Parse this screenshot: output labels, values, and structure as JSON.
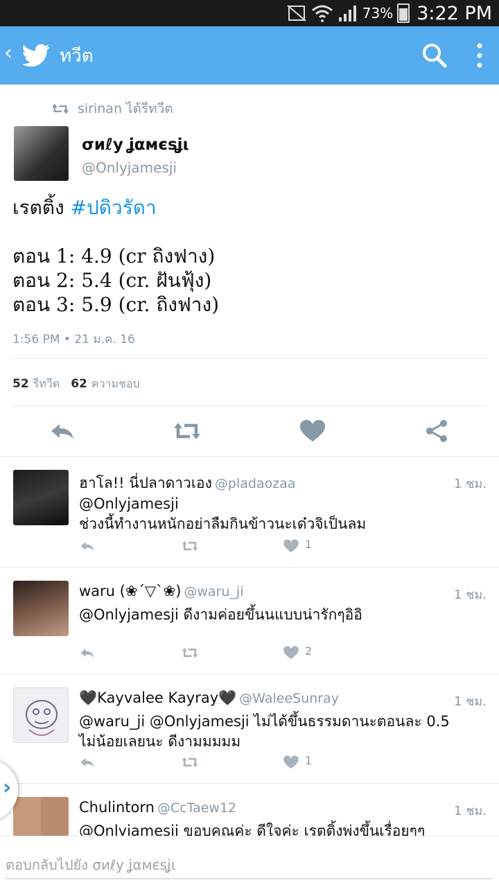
{
  "status_bar": {
    "battery": "73%",
    "time": "3:22 PM"
  },
  "app_bar": {
    "title": "ทวีต"
  },
  "main_tweet": {
    "retweeted_by": "sirinan ได้รีทวีต",
    "author_name": "σиℓу ʝαмєѕʝι",
    "author_handle": "@Onlyjamesji",
    "text_prefix": "เรตติ้ง ",
    "hashtag": "#ปดิวรัดา",
    "text_body": "\n\nตอน 1: 4.9 (cr ถิงฟาง)\nตอน 2: 5.4 (cr. ฝันฟุ้ง)\nตอน 3: 5.9 (cr. ถิงฟาง)",
    "timestamp": "1:56 PM • 21 ม.ค. 16",
    "retweets_count": "52",
    "retweets_label": "รีทวีต",
    "likes_count": "62",
    "likes_label": "ความชอบ"
  },
  "replies": [
    {
      "name": "ฮาโล!! นี่ปลาดาวเอง",
      "handle": "@pladaozaa",
      "time": "1 ชม.",
      "text": "@Onlyjamesji\nช่วงนี้ทำงานหนักอย่าลืมกินข้าวนะเด๋วจิเป็นลม",
      "likes": "1"
    },
    {
      "name": "waru (❀´▽`❀)",
      "handle": "@waru_ji",
      "time": "1 ชม.",
      "text": "@Onlyjamesji ดีงามค่อยขึ้นนแบบน่ารักๆอิอิ",
      "likes": "2"
    },
    {
      "name": "🖤Kayvalee Kayray🖤",
      "handle": "@WaleeSunray",
      "time": "1 ชม.",
      "text": "@waru_ji @Onlyjamesji ไม่ได้ขึ้นธรรมดานะตอนละ 0.5\nไม่น้อยเลยนะ ดีงามมมมม",
      "likes": "1"
    },
    {
      "name": "Chulintorn",
      "handle": "@CcTaew12",
      "time": "1 ชม.",
      "text": "@Onlyjamesji ขอบคุณค่ะ ดีใจค่ะ เรตติ้งพุ่งขึ้นเรื่อยๆๆ",
      "likes": ""
    }
  ],
  "compose": {
    "placeholder": "ตอบกลับไปยัง σиℓу ʝαмєѕʝι"
  },
  "colors": {
    "app_bar": "#55acee",
    "secondary_text": "#8899a6",
    "hashtag": "#1b95e0",
    "status_bar": "#1a1a1a"
  },
  "icons": [
    "back-icon",
    "twitter-bird-icon",
    "search-icon",
    "more-icon",
    "retweet-icon",
    "reply-icon",
    "heart-icon",
    "share-icon"
  ]
}
